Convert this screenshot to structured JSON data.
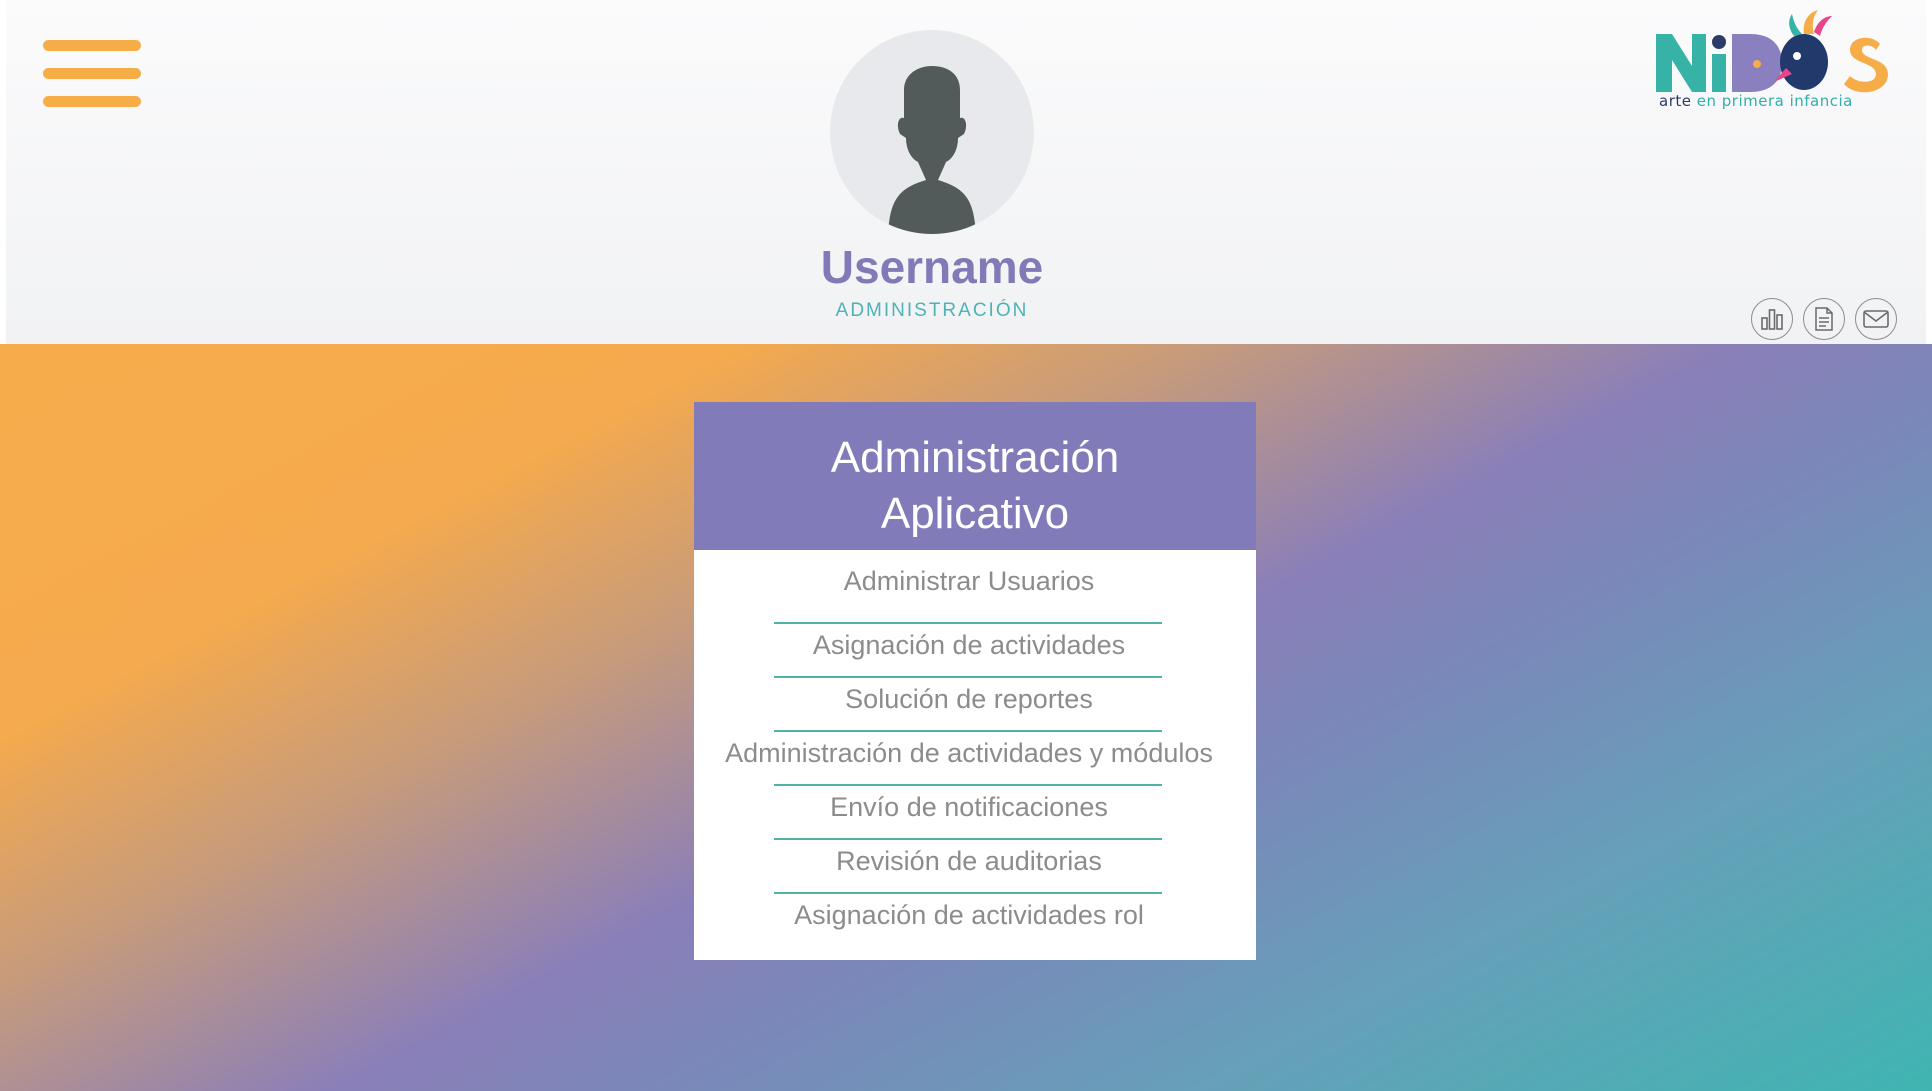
{
  "header": {
    "menu_icon": "hamburger-menu-icon",
    "username": "Username",
    "role": "ADMINISTRACIÓN",
    "logo": {
      "text": "NiDOS",
      "tagline_prefix": "arte",
      "tagline_rest": "en primera infancia"
    },
    "action_icons": [
      "bar-chart-icon",
      "document-icon",
      "mail-icon"
    ]
  },
  "card": {
    "title_line1": "Administración",
    "title_line2": "Aplicativo",
    "items": [
      "Administrar Usuarios",
      "Asignación de actividades",
      "Solución de reportes",
      "Administración de actividades y módulos",
      "Envío de notificaciones",
      "Revisión de auditorias",
      "Asignación de actividades rol"
    ]
  },
  "colors": {
    "accent_orange": "#f7ad47",
    "accent_purple": "#817bba",
    "accent_teal": "#4fb2b7"
  }
}
